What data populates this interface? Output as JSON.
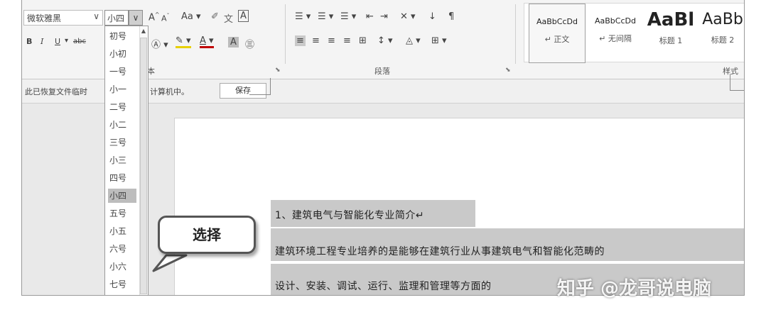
{
  "ribbon": {
    "font_name": "微软雅黑",
    "font_size": "小四",
    "grow_font": "A",
    "shrink_font": "A",
    "change_case": "Aa",
    "clear_format": "A",
    "bold": "B",
    "italic": "I",
    "underline": "U",
    "strike": "abc",
    "font_group_label": "本",
    "paragraph_group_label": "段落",
    "styles_group_label": "样式",
    "styles": [
      {
        "preview": "AaBbCcDd",
        "name": "↵ 正文"
      },
      {
        "preview": "AaBbCcDd",
        "name": "↵ 无间隔"
      },
      {
        "preview": "AaBl",
        "name": "标题 1"
      },
      {
        "preview": "AaBb",
        "name": "标题 2"
      }
    ]
  },
  "infobar": {
    "text_left": "此已恢复文件临时",
    "text_right": "计算机中。",
    "save_button": "保存"
  },
  "size_dropdown": {
    "items": [
      "初号",
      "小初",
      "一号",
      "小一",
      "二号",
      "小二",
      "三号",
      "小三",
      "四号",
      "小四",
      "五号",
      "小五",
      "六号",
      "小六",
      "七号"
    ],
    "selected": "小四"
  },
  "document": {
    "heading": "1、建筑电气与智能化专业简介↵",
    "line2": "建筑环境工程专业培养的是能够在建筑行业从事建筑电气和智能化范畴的",
    "line3": "设计、安装、调试、运行、监理和管理等方面的"
  },
  "callout": {
    "text": "选择"
  },
  "watermark": "知乎 @龙哥说电脑"
}
